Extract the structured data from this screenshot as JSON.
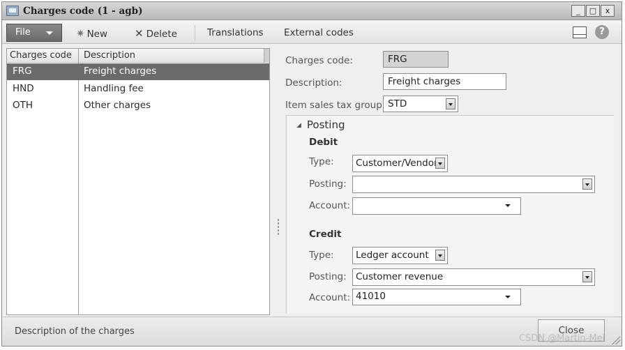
{
  "window": {
    "title": "Charges code (1 - agb)",
    "controls": [
      "_",
      "□",
      "x"
    ]
  },
  "toolbar": {
    "file_label": "File",
    "new_label": "New",
    "delete_label": "Delete",
    "translations_label": "Translations",
    "external_codes_label": "External codes"
  },
  "grid": {
    "columns": [
      "Charges code",
      "Description"
    ],
    "rows": [
      {
        "code": "FRG",
        "description": "Freight charges",
        "selected": true
      },
      {
        "code": "HND",
        "description": "Handling fee",
        "selected": false
      },
      {
        "code": "OTH",
        "description": "Other charges",
        "selected": false
      }
    ]
  },
  "details": {
    "charges_code_label": "Charges code:",
    "charges_code_value": "FRG",
    "description_label": "Description:",
    "description_value": "Freight charges",
    "tax_group_label": "Item sales tax group:",
    "tax_group_value": "STD"
  },
  "posting": {
    "section_title": "Posting",
    "debit": {
      "heading": "Debit",
      "type_label": "Type:",
      "type_value": "Customer/Vendor",
      "posting_label": "Posting:",
      "posting_value": "",
      "account_label": "Account:",
      "account_value": ""
    },
    "credit": {
      "heading": "Credit",
      "type_label": "Type:",
      "type_value": "Ledger account",
      "posting_label": "Posting:",
      "posting_value": "Customer revenue",
      "account_label": "Account:",
      "account_value": "41010"
    }
  },
  "status": {
    "text": "Description of the charges",
    "close_label": "Close"
  },
  "watermark": "CSDN @Martin-Mei"
}
